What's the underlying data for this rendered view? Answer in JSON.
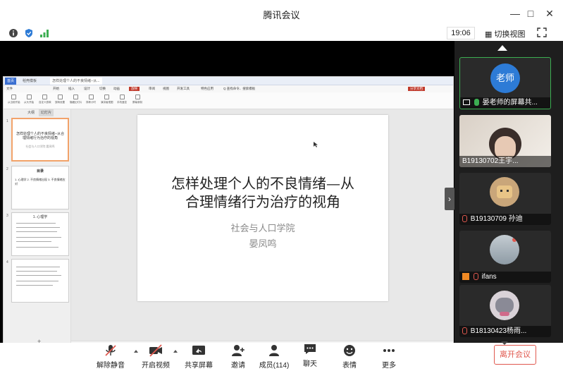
{
  "window": {
    "title": "腾讯会议",
    "minimize_icon": "minimize-icon",
    "maximize_icon": "maximize-icon",
    "close_icon": "close-icon"
  },
  "toolbar": {
    "time": "19:06",
    "switch_view_label": "切换视图"
  },
  "shared_screen": {
    "app_tabs": [
      "首页",
      "稻壳模板",
      "怎样处理个人的不良情绪--从..."
    ],
    "ribbon_tabs": [
      "文件",
      "开始",
      "插入",
      "设计",
      "切换",
      "动画",
      "放映",
      "审阅",
      "视图",
      "开发工具",
      "特色应用",
      "Q 查找命令、搜索模板"
    ],
    "ribbon_right": "分享文档",
    "ribbon_items": [
      "从当前开始",
      "从头开始",
      "自定义放映",
      "放映设置",
      "隐藏幻灯片",
      "排练计时",
      "演讲者视图",
      "手机遥控",
      "屏幕录制"
    ],
    "thumb_panel_tabs": [
      "大纲",
      "幻灯片"
    ],
    "thumbnails": [
      {
        "num": "1",
        "title": "怎样处理个人的不良情绪--从合理情绪行为治疗的视角",
        "sub": "社会与人口学院 晏凤鸣"
      },
      {
        "num": "2",
        "title": "目录",
        "sub": "1. 心理学 2. 不良情绪出现 3. 不良情绪应对"
      },
      {
        "num": "3",
        "title": "1. 心理学",
        "sub": ""
      },
      {
        "num": "4",
        "title": "",
        "sub": ""
      }
    ],
    "slide": {
      "title_line1": "怎样处理个人的不良情绪—从",
      "title_line2": "合理情绪行为治疗的视角",
      "subtitle1": "社会与人口学院",
      "subtitle2": "晏凤鸣"
    },
    "notes_placeholder": "单击此处添加备注",
    "status": {
      "slide_count": "幻灯片 1 / 31",
      "theme": "Office 主题",
      "backup": "文档已保存",
      "zoom": "118%",
      "ai": "AI·智能美化"
    }
  },
  "participants": [
    {
      "name": "晏老师的屏幕共...",
      "avatar_text": "老师",
      "avatar_color": "#2d7bd6",
      "muted": false,
      "sharing": true
    },
    {
      "name": "B19130702王宇...",
      "avatar_text": "",
      "avatar_color": "#cdbfb3",
      "muted": false,
      "sharing": false
    },
    {
      "name": "B19130709 孙迪",
      "avatar_text": "",
      "avatar_color": "#c9a67a",
      "muted": true,
      "sharing": false
    },
    {
      "name": "ifans",
      "avatar_text": "",
      "avatar_color": "#9aa7b0",
      "muted": true,
      "sharing": false
    },
    {
      "name": "B18130423杨雨...",
      "avatar_text": "",
      "avatar_color": "#d9d2d8",
      "muted": true,
      "sharing": false
    }
  ],
  "bottom_bar": {
    "unmute": "解除静音",
    "start_video": "开启视频",
    "share_screen": "共享屏幕",
    "invite": "邀请",
    "members": "成员(114)",
    "chat": "聊天",
    "reactions": "表情",
    "more": "更多",
    "leave": "离开会议"
  },
  "colors": {
    "accent_green": "#3cae52",
    "leave_red": "#e0584e",
    "teacher_blue": "#2d7bd6"
  }
}
